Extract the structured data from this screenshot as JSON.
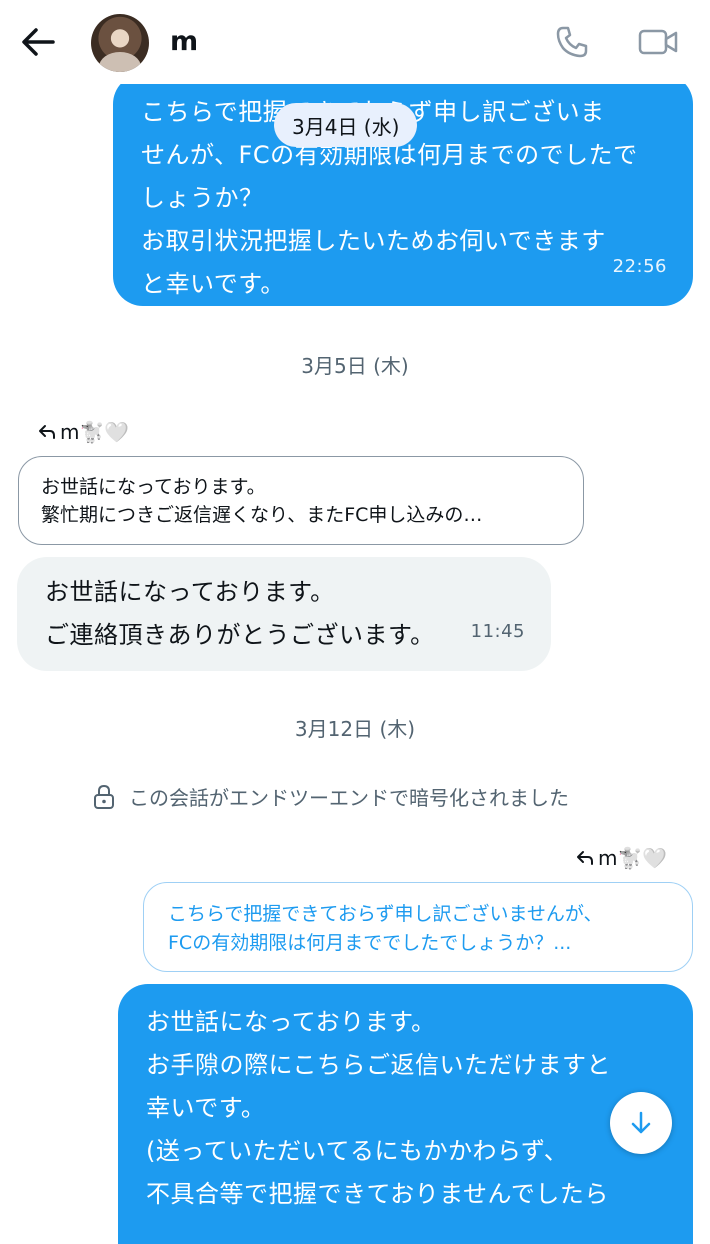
{
  "header": {
    "name": "m"
  },
  "messages_top": {
    "date_pill": "3月4日 (水)",
    "outgoing_1": {
      "lines": [
        "こちらで把握できておらず申し訳ございま",
        "せんが、FCの有効期限は何月までのでしたで",
        "しょうか？",
        "お取引状況把握したいためお伺いできます",
        "と幸いです。"
      ],
      "time": "22:56"
    }
  },
  "day2": {
    "date": "3月5日 (木)",
    "reply_tag": "m🐩🤍",
    "quoted_lines": [
      "お世話になっております。",
      "繁忙期につきご返信遅くなり、またFC申し込みの…"
    ],
    "incoming_1": {
      "lines": [
        "お世話になっております。",
        "ご連絡頂きありがとうございます。"
      ],
      "time": "11:45"
    }
  },
  "day3": {
    "date": "3月12日 (木)",
    "encryption_notice": "この会話がエンドツーエンドで暗号化されました",
    "reply_tag": "m🐩🤍",
    "quoted_lines": [
      "こちらで把握できておらず申し訳ございませんが、",
      "FCの有効期限は何月まででしたでしょうか？..."
    ],
    "outgoing_2": {
      "lines": [
        "お世話になっております。",
        "お手隙の際にこちらご返信いただけますと",
        "幸いです。",
        "(送っていただいてるにもかかわらず、",
        "不具合等で把握できておりませんでしたら"
      ]
    }
  },
  "icons": {
    "back": "arrow-left-icon",
    "phone": "phone-icon",
    "video": "video-camera-icon",
    "lock": "lock-icon",
    "reply": "reply-arrow-icon",
    "scroll_down": "arrow-down-icon"
  },
  "colors": {
    "accent": "#1d9bf0",
    "incoming": "#eff3f4",
    "muted": "#536471"
  }
}
